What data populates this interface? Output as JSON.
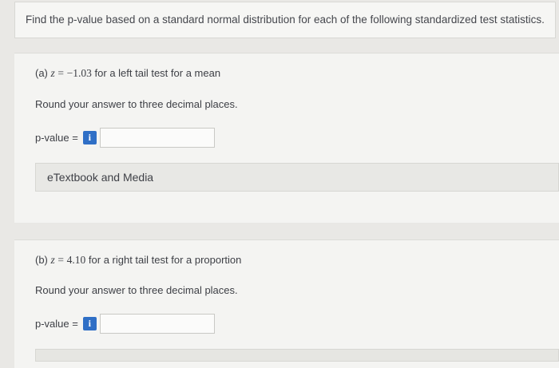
{
  "question": {
    "text": "Find the p-value based on a standard normal distribution for each of the following standardized test statistics."
  },
  "part_a": {
    "label": "(a)",
    "z_symbol": "z",
    "equals": "=",
    "z_value": "−1.03",
    "description": "for a left tail test for a mean",
    "instruction": "Round your answer to three decimal places.",
    "answer_label": "p-value =",
    "info_icon": "i",
    "answer_value": "",
    "resources_label": "eTextbook and Media"
  },
  "part_b": {
    "label": "(b)",
    "z_symbol": "z",
    "equals": "=",
    "z_value": "4.10",
    "description": "for a right tail test for a proportion",
    "instruction": "Round your answer to three decimal places.",
    "answer_label": "p-value =",
    "info_icon": "i",
    "answer_value": ""
  },
  "colors": {
    "info_button": "#2f6fc6",
    "background": "#e9e8e5"
  }
}
